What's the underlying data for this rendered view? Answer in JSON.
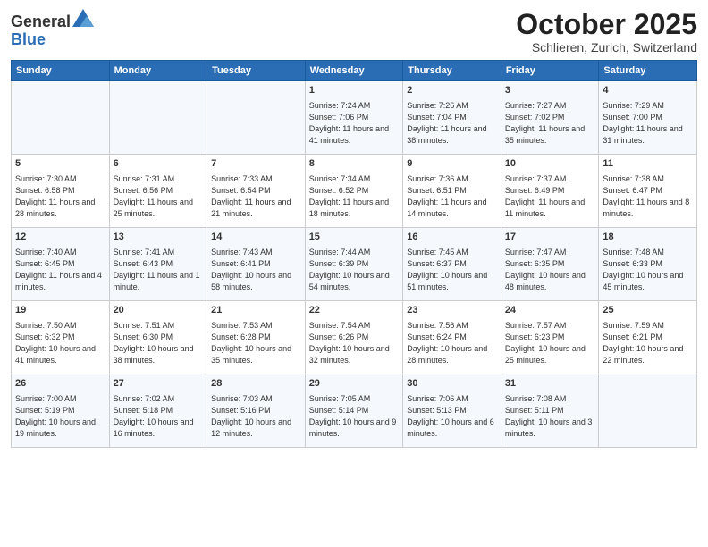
{
  "header": {
    "logo_general": "General",
    "logo_blue": "Blue",
    "month_title": "October 2025",
    "location": "Schlieren, Zurich, Switzerland"
  },
  "weekdays": [
    "Sunday",
    "Monday",
    "Tuesday",
    "Wednesday",
    "Thursday",
    "Friday",
    "Saturday"
  ],
  "weeks": [
    [
      {
        "day": "",
        "sunrise": "",
        "sunset": "",
        "daylight": ""
      },
      {
        "day": "",
        "sunrise": "",
        "sunset": "",
        "daylight": ""
      },
      {
        "day": "",
        "sunrise": "",
        "sunset": "",
        "daylight": ""
      },
      {
        "day": "1",
        "sunrise": "Sunrise: 7:24 AM",
        "sunset": "Sunset: 7:06 PM",
        "daylight": "Daylight: 11 hours and 41 minutes."
      },
      {
        "day": "2",
        "sunrise": "Sunrise: 7:26 AM",
        "sunset": "Sunset: 7:04 PM",
        "daylight": "Daylight: 11 hours and 38 minutes."
      },
      {
        "day": "3",
        "sunrise": "Sunrise: 7:27 AM",
        "sunset": "Sunset: 7:02 PM",
        "daylight": "Daylight: 11 hours and 35 minutes."
      },
      {
        "day": "4",
        "sunrise": "Sunrise: 7:29 AM",
        "sunset": "Sunset: 7:00 PM",
        "daylight": "Daylight: 11 hours and 31 minutes."
      }
    ],
    [
      {
        "day": "5",
        "sunrise": "Sunrise: 7:30 AM",
        "sunset": "Sunset: 6:58 PM",
        "daylight": "Daylight: 11 hours and 28 minutes."
      },
      {
        "day": "6",
        "sunrise": "Sunrise: 7:31 AM",
        "sunset": "Sunset: 6:56 PM",
        "daylight": "Daylight: 11 hours and 25 minutes."
      },
      {
        "day": "7",
        "sunrise": "Sunrise: 7:33 AM",
        "sunset": "Sunset: 6:54 PM",
        "daylight": "Daylight: 11 hours and 21 minutes."
      },
      {
        "day": "8",
        "sunrise": "Sunrise: 7:34 AM",
        "sunset": "Sunset: 6:52 PM",
        "daylight": "Daylight: 11 hours and 18 minutes."
      },
      {
        "day": "9",
        "sunrise": "Sunrise: 7:36 AM",
        "sunset": "Sunset: 6:51 PM",
        "daylight": "Daylight: 11 hours and 14 minutes."
      },
      {
        "day": "10",
        "sunrise": "Sunrise: 7:37 AM",
        "sunset": "Sunset: 6:49 PM",
        "daylight": "Daylight: 11 hours and 11 minutes."
      },
      {
        "day": "11",
        "sunrise": "Sunrise: 7:38 AM",
        "sunset": "Sunset: 6:47 PM",
        "daylight": "Daylight: 11 hours and 8 minutes."
      }
    ],
    [
      {
        "day": "12",
        "sunrise": "Sunrise: 7:40 AM",
        "sunset": "Sunset: 6:45 PM",
        "daylight": "Daylight: 11 hours and 4 minutes."
      },
      {
        "day": "13",
        "sunrise": "Sunrise: 7:41 AM",
        "sunset": "Sunset: 6:43 PM",
        "daylight": "Daylight: 11 hours and 1 minute."
      },
      {
        "day": "14",
        "sunrise": "Sunrise: 7:43 AM",
        "sunset": "Sunset: 6:41 PM",
        "daylight": "Daylight: 10 hours and 58 minutes."
      },
      {
        "day": "15",
        "sunrise": "Sunrise: 7:44 AM",
        "sunset": "Sunset: 6:39 PM",
        "daylight": "Daylight: 10 hours and 54 minutes."
      },
      {
        "day": "16",
        "sunrise": "Sunrise: 7:45 AM",
        "sunset": "Sunset: 6:37 PM",
        "daylight": "Daylight: 10 hours and 51 minutes."
      },
      {
        "day": "17",
        "sunrise": "Sunrise: 7:47 AM",
        "sunset": "Sunset: 6:35 PM",
        "daylight": "Daylight: 10 hours and 48 minutes."
      },
      {
        "day": "18",
        "sunrise": "Sunrise: 7:48 AM",
        "sunset": "Sunset: 6:33 PM",
        "daylight": "Daylight: 10 hours and 45 minutes."
      }
    ],
    [
      {
        "day": "19",
        "sunrise": "Sunrise: 7:50 AM",
        "sunset": "Sunset: 6:32 PM",
        "daylight": "Daylight: 10 hours and 41 minutes."
      },
      {
        "day": "20",
        "sunrise": "Sunrise: 7:51 AM",
        "sunset": "Sunset: 6:30 PM",
        "daylight": "Daylight: 10 hours and 38 minutes."
      },
      {
        "day": "21",
        "sunrise": "Sunrise: 7:53 AM",
        "sunset": "Sunset: 6:28 PM",
        "daylight": "Daylight: 10 hours and 35 minutes."
      },
      {
        "day": "22",
        "sunrise": "Sunrise: 7:54 AM",
        "sunset": "Sunset: 6:26 PM",
        "daylight": "Daylight: 10 hours and 32 minutes."
      },
      {
        "day": "23",
        "sunrise": "Sunrise: 7:56 AM",
        "sunset": "Sunset: 6:24 PM",
        "daylight": "Daylight: 10 hours and 28 minutes."
      },
      {
        "day": "24",
        "sunrise": "Sunrise: 7:57 AM",
        "sunset": "Sunset: 6:23 PM",
        "daylight": "Daylight: 10 hours and 25 minutes."
      },
      {
        "day": "25",
        "sunrise": "Sunrise: 7:59 AM",
        "sunset": "Sunset: 6:21 PM",
        "daylight": "Daylight: 10 hours and 22 minutes."
      }
    ],
    [
      {
        "day": "26",
        "sunrise": "Sunrise: 7:00 AM",
        "sunset": "Sunset: 5:19 PM",
        "daylight": "Daylight: 10 hours and 19 minutes."
      },
      {
        "day": "27",
        "sunrise": "Sunrise: 7:02 AM",
        "sunset": "Sunset: 5:18 PM",
        "daylight": "Daylight: 10 hours and 16 minutes."
      },
      {
        "day": "28",
        "sunrise": "Sunrise: 7:03 AM",
        "sunset": "Sunset: 5:16 PM",
        "daylight": "Daylight: 10 hours and 12 minutes."
      },
      {
        "day": "29",
        "sunrise": "Sunrise: 7:05 AM",
        "sunset": "Sunset: 5:14 PM",
        "daylight": "Daylight: 10 hours and 9 minutes."
      },
      {
        "day": "30",
        "sunrise": "Sunrise: 7:06 AM",
        "sunset": "Sunset: 5:13 PM",
        "daylight": "Daylight: 10 hours and 6 minutes."
      },
      {
        "day": "31",
        "sunrise": "Sunrise: 7:08 AM",
        "sunset": "Sunset: 5:11 PM",
        "daylight": "Daylight: 10 hours and 3 minutes."
      },
      {
        "day": "",
        "sunrise": "",
        "sunset": "",
        "daylight": ""
      }
    ]
  ]
}
